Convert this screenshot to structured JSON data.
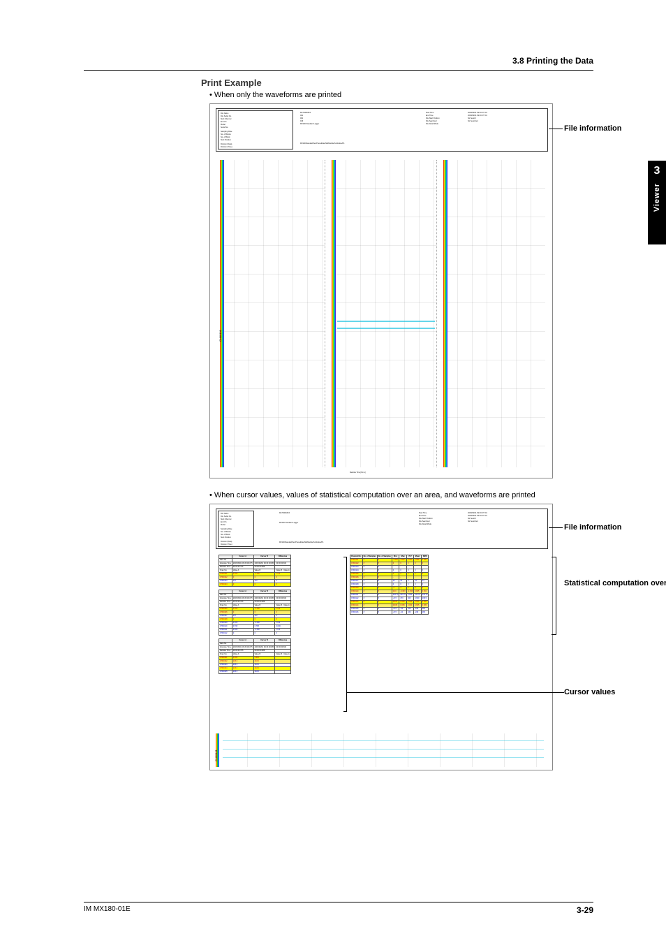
{
  "header": {
    "section": "3.8  Printing the Data"
  },
  "sidetab": {
    "chapter": "3",
    "label": "Viewer"
  },
  "headings": {
    "print_example": "Print Example"
  },
  "bullets": {
    "b1": "When only the waveforms are printed",
    "b2": "When cursor values, values of statistical computation over an area, and waveforms are printed"
  },
  "callouts": {
    "file_info": "File information",
    "statistical": "Statistical computation over an area",
    "cursor_values": "Cursor values"
  },
  "footer": {
    "doc_id": "IM MX180-01E",
    "page": "3-29"
  },
  "fig_meta": {
    "left_labels": [
      "File Name",
      "File Serial No.",
      "Start Channel",
      "End Ch",
      "Model",
      "Serial No.",
      "Sampling Rate",
      "No. of Blocks",
      "No. of Block",
      "Start Position",
      "Division (Data)",
      "Division (Time)"
    ],
    "right_labels": [
      "Start Time",
      "End Time",
      "File Start Position",
      "File Searched",
      "File Detail Mode"
    ],
    "left_values": [
      "Mx7000DATA",
      "001",
      "001",
      "016",
      "MX100 Standard Logger",
      "-",
      "2",
      "-",
      "-",
      "Module 1",
      "MX100Standard/Set/PresetData/StdModule/S-Module/P1",
      ""
    ],
    "right_values": [
      "2003/09/01 09:30:47.701",
      "2003/09/01 09:30:47.701",
      "No Search",
      "No Searched",
      "-"
    ],
    "axis_label": "CH00101",
    "x_axis": "Relative Time[h:m:s]"
  },
  "cursor_table": {
    "group_header": [
      "Data No.",
      "Absolute Time",
      "Relative Time",
      "Scan No."
    ],
    "cols": [
      "Cursor A",
      "Cursor B",
      "Difference"
    ],
    "abs_a": "2003/09/01 09:30:48.075",
    "abs_b": "2003/09/01 09:30:48.689",
    "abs_d": "00:00:00.600",
    "rel_a": "00:00:00.375",
    "rel_b": "00:00:00.988",
    "scan_a": "Value A",
    "scan_b": "Value B",
    "scan_d": "Value B - Value A",
    "rows": [
      {
        "ch": "CH00101",
        "a": "4.009",
        "b": "-2.430",
        "d": "-6.44"
      },
      {
        "ch": "CH00102",
        "a": "0",
        "b": "0",
        "d": "0"
      },
      {
        "ch": "CH00103",
        "a": "237",
        "b": "237",
        "d": "0"
      },
      {
        "ch": "CH00104",
        "a": "0",
        "b": "0",
        "d": "0"
      },
      {
        "ch": "CH00105",
        "a": "4.009",
        "b": "-2.430",
        "d": "-6.44"
      },
      {
        "ch": "CH00106",
        "a": "0",
        "b": "0",
        "d": "0"
      },
      {
        "ch": "CH00107",
        "a": "237",
        "b": "237",
        "d": "0"
      },
      {
        "ch": "CH00108",
        "a": "0",
        "b": "0",
        "d": "0"
      },
      {
        "ch": "CH00109",
        "a": "4.009",
        "b": "-2.430",
        "d": "-6.44"
      },
      {
        "ch": "CH00110",
        "a": "0.768",
        "b": "0.768",
        "d": "0.000"
      },
      {
        "ch": "CH00111",
        "a": "4.009",
        "b": "-2.430",
        "d": "-6.44"
      },
      {
        "ch": "CH00112",
        "a": "0",
        "b": "0",
        "d": "0"
      }
    ],
    "rows2": [
      {
        "ch": "CH00101",
        "a": "4.009",
        "b": "2.430",
        "d": ""
      },
      {
        "ch": "CH00102",
        "a": "243.0",
        "b": "243.0",
        "d": ""
      },
      {
        "ch": "CH00103",
        "a": "243.0",
        "b": "243.0",
        "d": ""
      },
      {
        "ch": "CH00104",
        "a": "243.0",
        "b": "243.0",
        "d": ""
      },
      {
        "ch": "CH00105",
        "a": "243.0",
        "b": "243.0",
        "d": ""
      }
    ]
  },
  "stat_table": {
    "cols": [
      "Channel No.",
      "No. of Samples",
      "No. of Samples",
      "Min.",
      "Max",
      "P-P",
      "Mean",
      "RMS"
    ],
    "rows": [
      {
        "c": [
          "CH00101",
          "8",
          "8",
          "-4.546",
          "4.845",
          "9.391",
          "0.688",
          "3.690"
        ]
      },
      {
        "c": [
          "CH00102",
          "8",
          "8",
          "0",
          "0",
          "0",
          "0",
          "0"
        ]
      },
      {
        "c": [
          "CH00103",
          "8",
          "8",
          "-",
          "-",
          "-",
          "-",
          "-"
        ]
      },
      {
        "c": [
          "CH00104",
          "8",
          "8",
          "0",
          "0",
          "0",
          "0",
          "0"
        ]
      },
      {
        "c": [
          "CH00105",
          "8",
          "8",
          "0",
          "0",
          "0",
          "0",
          "0"
        ]
      },
      {
        "c": [
          "CH00106",
          "8",
          "8",
          "-",
          "-",
          "-",
          "-",
          "-"
        ]
      },
      {
        "c": [
          "CH00107",
          "8",
          "8",
          "24",
          "24",
          "0",
          "24",
          "24"
        ]
      },
      {
        "c": [
          "CH00108",
          "8",
          "8",
          "0",
          "0",
          "0",
          "0",
          "0"
        ]
      },
      {
        "c": [
          "CH00109",
          "8",
          "8",
          "-4",
          "4",
          "8",
          "0",
          "3"
        ]
      },
      {
        "c": [
          "CH00110",
          "8",
          "8",
          "0.00",
          "-0.363",
          "-4.546",
          "0.845",
          "0.391"
        ]
      },
      {
        "c": [
          "CH00111",
          "8",
          "8",
          "243.70",
          "243.70",
          "0.000",
          "243.70",
          "243.70"
        ]
      },
      {
        "c": [
          "CH00112",
          "8",
          "8",
          "-473",
          "473",
          "946",
          "0.600",
          "238.5"
        ]
      },
      {
        "c": [
          "CH00113",
          "8",
          "8",
          "0.605",
          "0.605",
          "0.000",
          "0.605",
          "0.605"
        ]
      },
      {
        "c": [
          "CH00114",
          "8",
          "8",
          "0.605",
          "0.605",
          "0.000",
          "0.605",
          "0.605"
        ]
      },
      {
        "c": [
          "CH00115",
          "8",
          "8",
          "-473",
          "-24",
          "449",
          "-249",
          "283"
        ]
      },
      {
        "c": [
          "CH00116",
          "8",
          "8",
          "-473",
          "-24",
          "449",
          "-249",
          "283"
        ]
      }
    ]
  }
}
